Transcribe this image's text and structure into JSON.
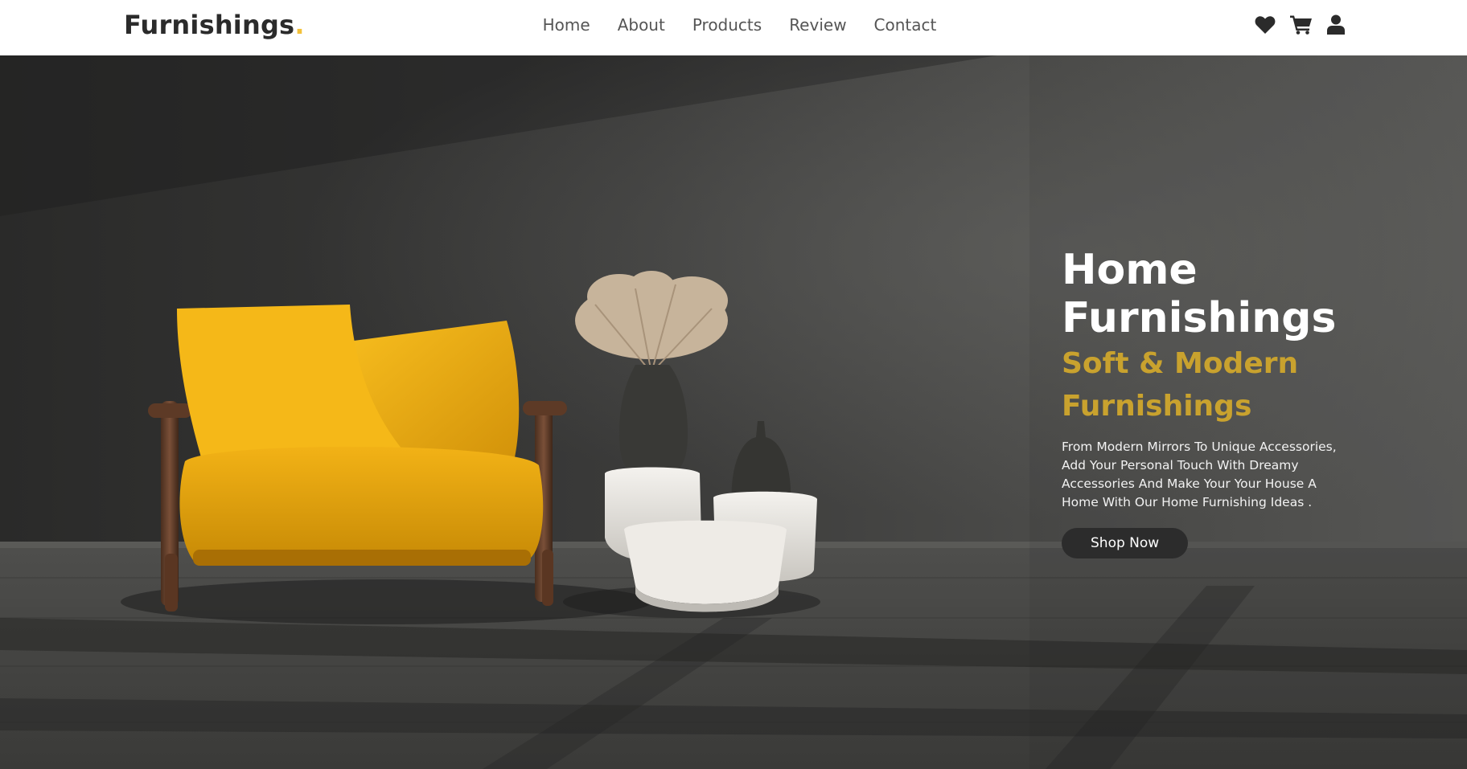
{
  "header": {
    "logo_text": "Furnishings",
    "logo_dot": ".",
    "nav": [
      "Home",
      "About",
      "Products",
      "Review",
      "Contact"
    ],
    "icons": [
      "heart-icon",
      "cart-icon",
      "user-icon"
    ]
  },
  "hero": {
    "title_line1": "Home",
    "title_line2": "Furnishings",
    "subtitle_line1": "Soft & Modern",
    "subtitle_line2": "Furnishings",
    "description": "From Modern Mirrors To Unique Accessories, Add Your Personal Touch With Dreamy Accessories And Make Your Your House A Home With Our Home Furnishing Ideas .",
    "button_label": "Shop Now"
  },
  "colors": {
    "accent": "#f3c13a",
    "subtitle": "#c9a22e",
    "button_bg": "#2c2c2c",
    "header_bg": "#ffffff"
  }
}
